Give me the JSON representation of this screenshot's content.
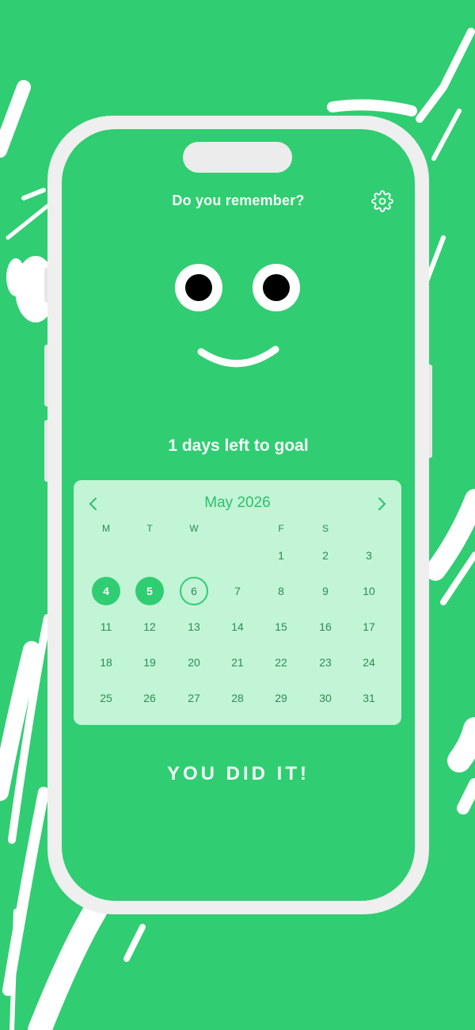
{
  "app": {
    "title": "Do you remember?",
    "settings_icon": "gear-icon"
  },
  "colors": {
    "background": "#31cd72",
    "calendar_card": "#c2f5d6",
    "accent": "#31cd72",
    "day_text": "#2c8b56"
  },
  "status": {
    "goal_text": "1 days left to goal",
    "result_text": "YOU DID IT!"
  },
  "calendar": {
    "month_label": "May 2026",
    "prev_icon": "chevron-left-icon",
    "next_icon": "chevron-right-icon",
    "weekdays": [
      "M",
      "T",
      "W",
      "",
      "F",
      "S",
      ""
    ],
    "first_weekday_index": 4,
    "days_in_month": 31,
    "days": [
      "1",
      "2",
      "3",
      "4",
      "5",
      "6",
      "7",
      "8",
      "9",
      "10",
      "11",
      "12",
      "13",
      "14",
      "15",
      "16",
      "17",
      "18",
      "19",
      "20",
      "21",
      "22",
      "23",
      "24",
      "25",
      "26",
      "27",
      "28",
      "29",
      "30",
      "31"
    ],
    "completed_days": [
      4,
      5
    ],
    "today": 6
  }
}
